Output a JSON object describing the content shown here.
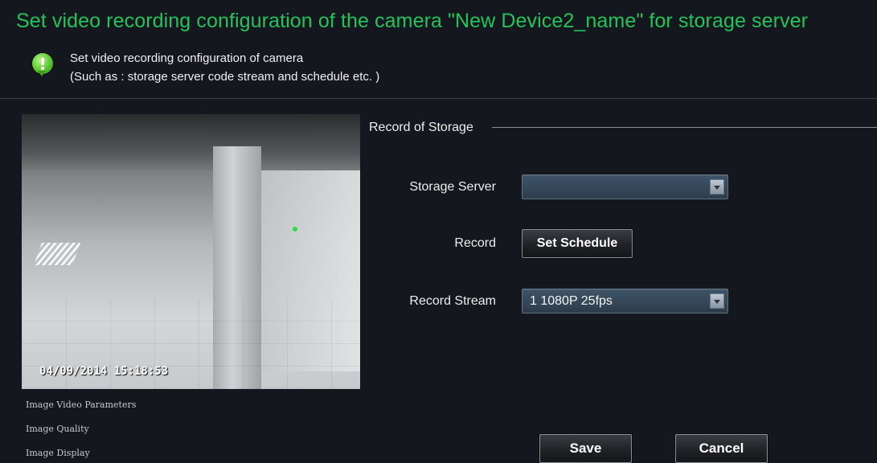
{
  "header": {
    "title": "Set video recording configuration of the camera \"New Device2_name\" for storage server",
    "info_icon": "info-bubble-icon",
    "description_line1": "Set video recording configuration of camera",
    "description_line2": "(Such as : storage server code stream and schedule etc. )"
  },
  "preview": {
    "timestamp": "04/09/2014  15:18:53"
  },
  "side_links": [
    {
      "label": "Image Video Parameters"
    },
    {
      "label": "Image Quality"
    },
    {
      "label": "Image Display"
    }
  ],
  "storage": {
    "group_title": "Record of Storage",
    "storage_server_label": "Storage Server",
    "storage_server_value": "",
    "record_label": "Record",
    "set_schedule_label": "Set Schedule",
    "record_stream_label": "Record Stream",
    "record_stream_value": "1 1080P 25fps",
    "dropdown_icon": "chevron-down-icon"
  },
  "footer": {
    "save_label": "Save",
    "cancel_label": "Cancel"
  },
  "colors": {
    "background": "#14171d",
    "title": "#22c35a",
    "combo": "#34485a"
  }
}
